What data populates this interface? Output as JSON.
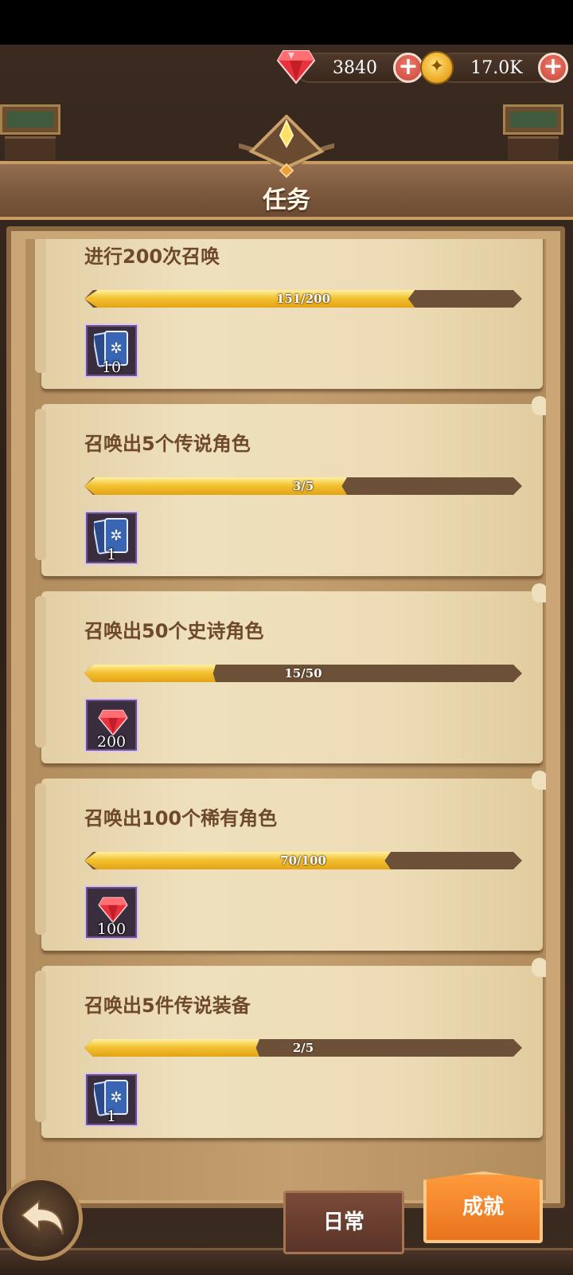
{
  "currency": {
    "gems": "3840",
    "gold": "17.0K",
    "plus": "+"
  },
  "header": {
    "title": "任务"
  },
  "tasks": [
    {
      "title": "进行200次召唤",
      "progress_text": "151/200",
      "progress": 0.755,
      "reward_type": "card",
      "reward_count": "10"
    },
    {
      "title": "召唤出5个传说角色",
      "progress_text": "3/5",
      "progress": 0.6,
      "reward_type": "card",
      "reward_count": "1"
    },
    {
      "title": "召唤出50个史诗角色",
      "progress_text": "15/50",
      "progress": 0.3,
      "reward_type": "gem",
      "reward_count": "200"
    },
    {
      "title": "召唤出100个稀有角色",
      "progress_text": "70/100",
      "progress": 0.7,
      "reward_type": "gem",
      "reward_count": "100"
    },
    {
      "title": "召唤出5件传说装备",
      "progress_text": "2/5",
      "progress": 0.4,
      "reward_type": "card",
      "reward_count": "1"
    }
  ],
  "tabs": {
    "daily": "日常",
    "achievement": "成就"
  },
  "colors": {
    "accent_orange": "#f0842a",
    "progress_gold": "#f3c232",
    "parchment": "#eddcb6"
  }
}
